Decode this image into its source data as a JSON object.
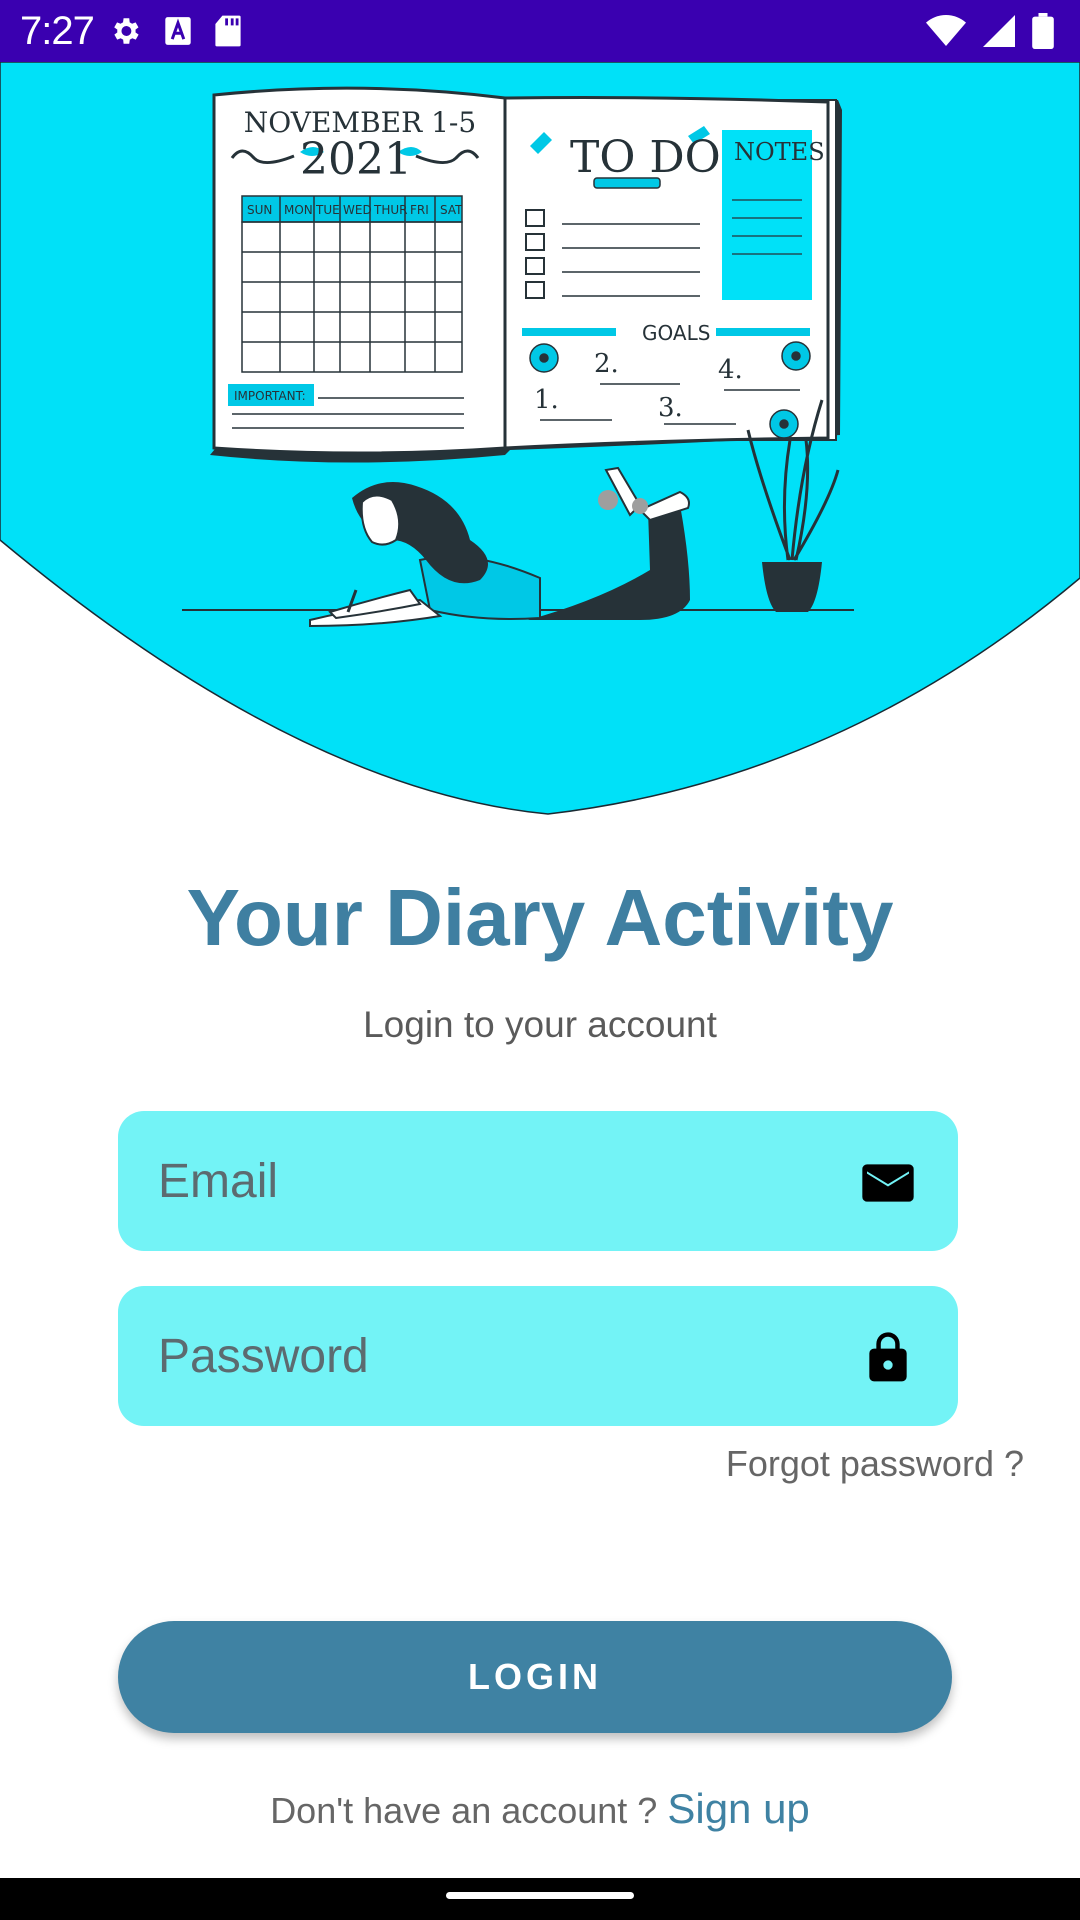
{
  "status_bar": {
    "time": "7:27",
    "left_icons": [
      "gear-icon",
      "a-notification-icon",
      "sd-card-icon"
    ],
    "right_icons": [
      "wifi-icon",
      "signal-icon",
      "battery-icon"
    ],
    "color": "#3a00b0"
  },
  "hero": {
    "background_color": "#00e1f8",
    "planner": {
      "date_title": "NOVEMBER 1-5",
      "year": "2021",
      "weekdays": [
        "SUN",
        "MON",
        "TUE",
        "WED",
        "THUR",
        "FRI",
        "SAT"
      ],
      "important_label": "IMPORTANT:",
      "todo_title": "TO DO:",
      "notes_title": "NOTES",
      "goals_title": "GOALS",
      "goal_numbers": [
        "1.",
        "2.",
        "3.",
        "4."
      ]
    }
  },
  "app": {
    "title": "Your Diary Activity",
    "subtitle": "Login to your account",
    "title_color": "#3f7fa1"
  },
  "form": {
    "email": {
      "value": "",
      "placeholder": "Email",
      "icon": "mail-icon"
    },
    "password": {
      "value": "",
      "placeholder": "Password",
      "icon": "lock-icon"
    },
    "field_color": "#73f3f6",
    "forgot_label": "Forgot password ?",
    "login_label": "LOGIN",
    "button_color": "#3f82a3"
  },
  "signup": {
    "prompt": "Don't have an account ?",
    "link_label": "Sign up"
  }
}
